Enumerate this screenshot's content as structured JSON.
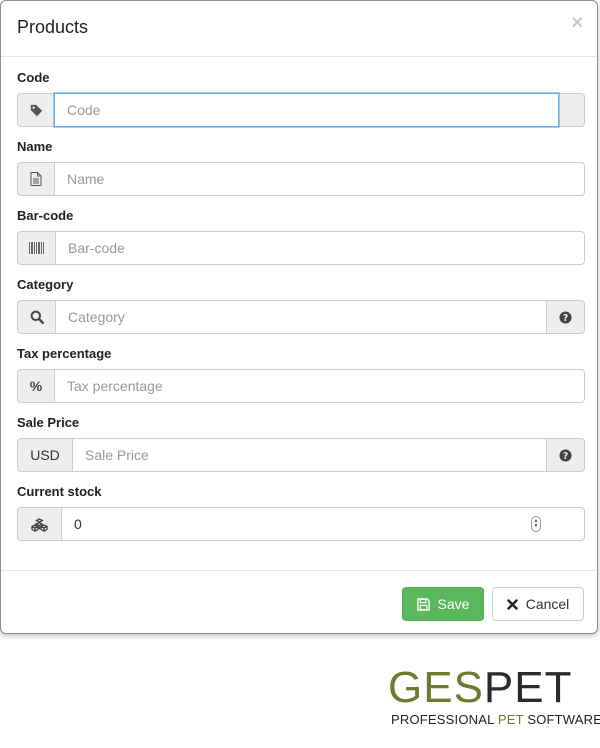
{
  "modal": {
    "title": "Products",
    "close_symbol": "×"
  },
  "fields": {
    "code": {
      "label": "Code",
      "placeholder": "Code",
      "icon": "tag-icon"
    },
    "name": {
      "label": "Name",
      "placeholder": "Name",
      "icon": "document-icon"
    },
    "barcode": {
      "label": "Bar-code",
      "placeholder": "Bar-code",
      "icon": "barcode-icon"
    },
    "category": {
      "label": "Category",
      "placeholder": "Category",
      "icon": "search-icon",
      "help_icon": "question-circle-icon"
    },
    "tax": {
      "label": "Tax percentage",
      "placeholder": "Tax percentage",
      "addon_text": "%"
    },
    "sale_price": {
      "label": "Sale Price",
      "placeholder": "Sale Price",
      "addon_text": "USD",
      "help_icon": "question-circle-icon"
    },
    "stock": {
      "label": "Current stock",
      "value": "0",
      "icon": "cubes-icon"
    }
  },
  "footer": {
    "save_label": "Save",
    "cancel_label": "Cancel"
  },
  "logo": {
    "ges": "GES",
    "pet": "PET",
    "sub_a": "PROFESSIONAL ",
    "sub_b": "PET",
    "sub_c": " SOFTWARE"
  },
  "colors": {
    "primary_focus": "#66afe9",
    "save_green": "#5cb85c",
    "logo_green": "#6f7a2e"
  }
}
